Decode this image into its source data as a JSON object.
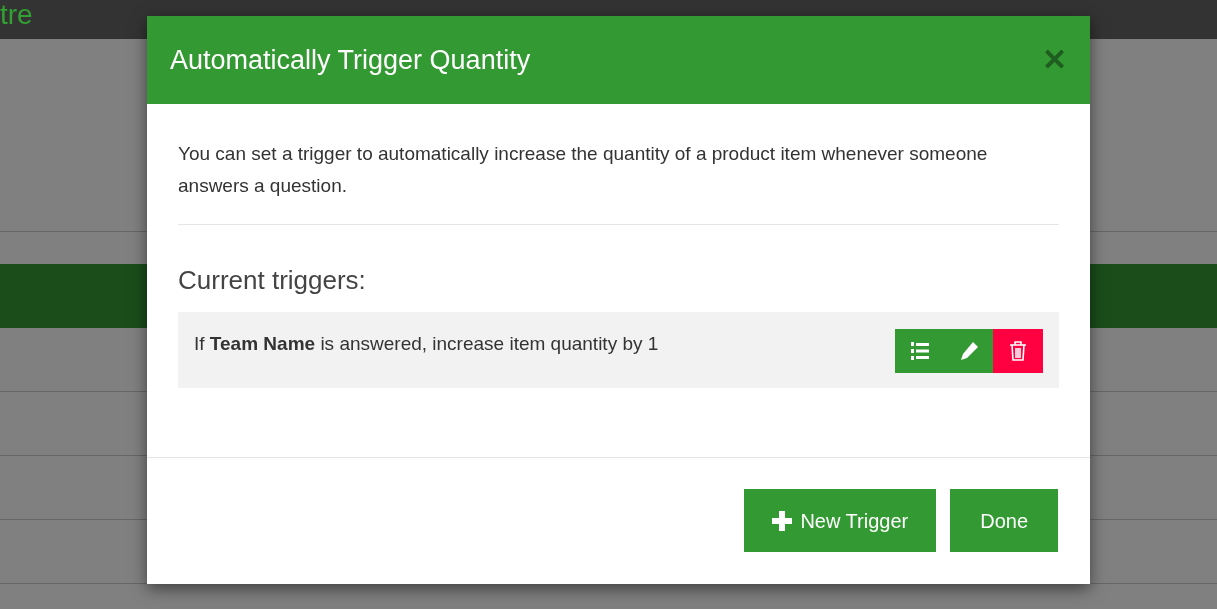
{
  "background": {
    "logo_fragment": "tre"
  },
  "dialog": {
    "title": "Automatically Trigger Quantity",
    "close": "✕",
    "description": "You can set a trigger to automatically increase the quantity of a product item whenever someone answers a question.",
    "triggers_heading": "Current triggers:",
    "triggers": [
      {
        "text": "If **Team Name** is answered, increase item quantity by 1"
      }
    ],
    "buttons": [
      {
        "kind": "new",
        "label": "New Trigger"
      },
      {
        "kind": "done",
        "label": "Done"
      }
    ]
  }
}
